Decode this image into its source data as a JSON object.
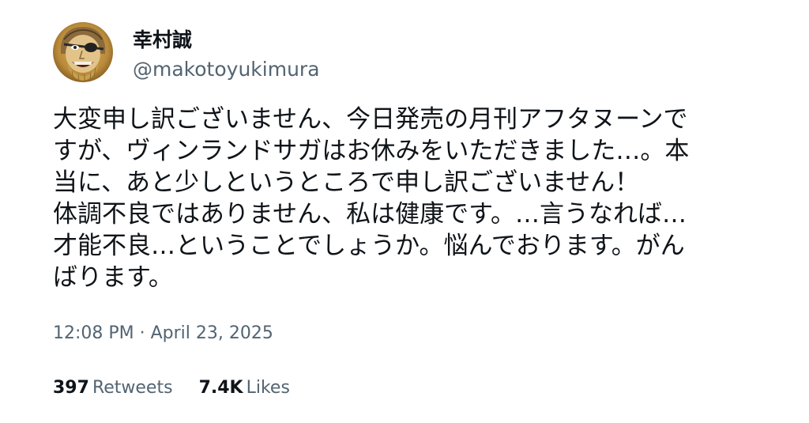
{
  "author": {
    "display_name": "幸村誠",
    "handle": "@makotoyukimura"
  },
  "tweet": {
    "lines": [
      "大変申し訳ございません、今日発売の月刊アフタヌーンで",
      "すが、ヴィンランドサガはお休みをいただきました…。本",
      "当に、あと少しというところで申し訳ございません！",
      "体調不良ではありません、私は健康です。…言うなれば…",
      "才能不良…ということでしょうか。悩んでおります。がん",
      "ばります。"
    ],
    "timestamp": "12:08 PM · April 23, 2025"
  },
  "stats": {
    "retweets_value": "397",
    "retweets_label": "Retweets",
    "likes_value": "7.4K",
    "likes_label": "Likes"
  },
  "colors": {
    "text_primary": "#0f1419",
    "text_secondary": "#536471",
    "background": "#ffffff"
  }
}
